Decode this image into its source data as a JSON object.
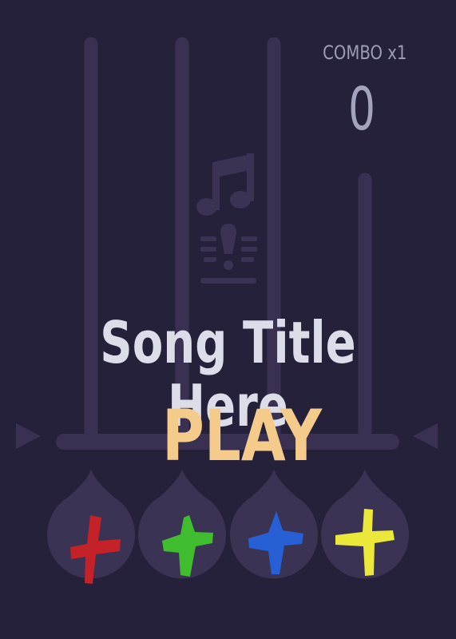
{
  "hud": {
    "combo_label": "COMBO x1",
    "score": "0"
  },
  "song": {
    "title": "Song Title Here"
  },
  "menu": {
    "play_label": "PLAY"
  },
  "lane_buttons": [
    {
      "lane": 1,
      "color": "#c42128"
    },
    {
      "lane": 2,
      "color": "#3fbd2f"
    },
    {
      "lane": 3,
      "color": "#2760d4"
    },
    {
      "lane": 4,
      "color": "#ebe83a"
    }
  ],
  "colors": {
    "background": "#26213a",
    "track": "#3a3152",
    "button_body": "#3b3353",
    "title_text": "#dcdde8",
    "play_text": "#f5cb8b",
    "hud_text": "#9c9cb5"
  }
}
